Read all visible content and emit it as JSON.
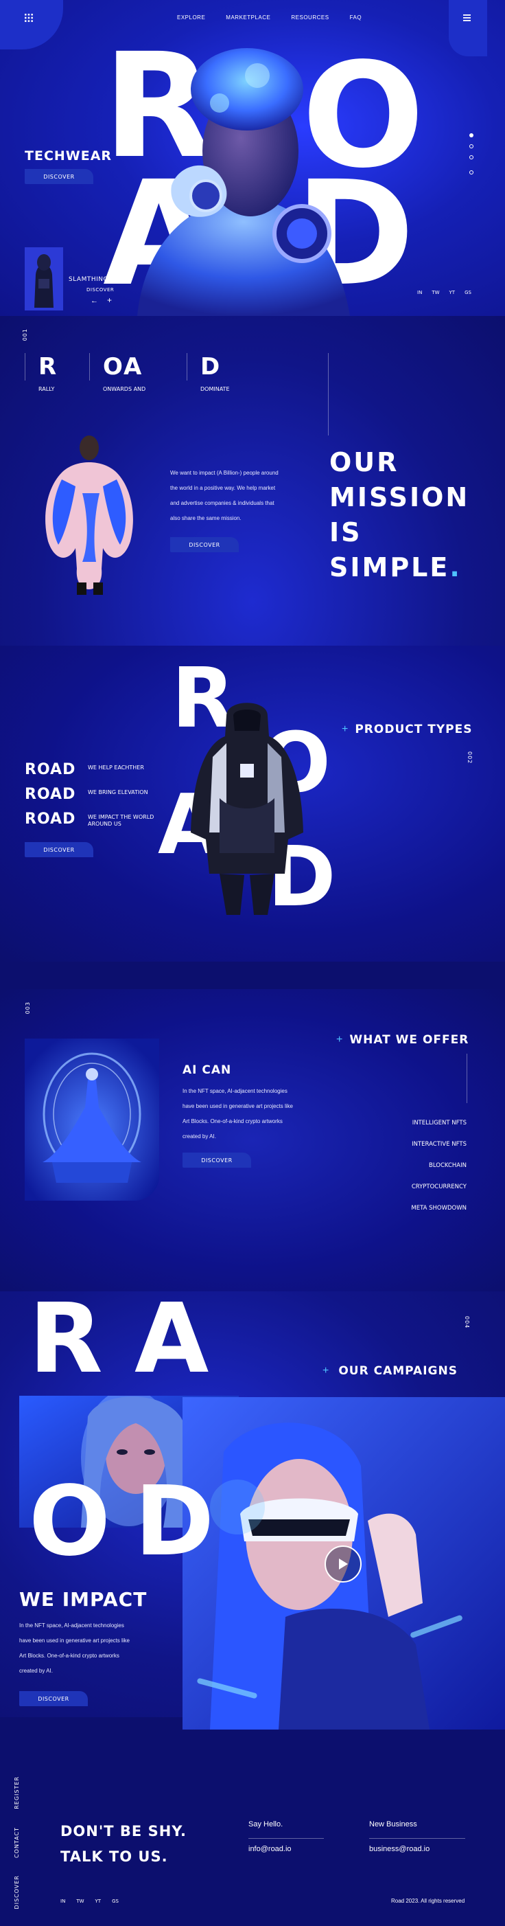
{
  "nav": {
    "items": [
      "EXPLORE",
      "MARKETPLACE",
      "RESOURCES",
      "FAQ"
    ]
  },
  "hero": {
    "big_letters": [
      "R",
      "O",
      "A",
      "D"
    ],
    "title": "TECHWEAR",
    "discover": "DISCOVER",
    "card_title": "SLAMTHINGS",
    "card_discover": "DISCOVER",
    "card_prev": "←",
    "card_next": "+",
    "socials": [
      "IN",
      "TW",
      "YT",
      "GS"
    ]
  },
  "section1": {
    "index": "001",
    "letters": [
      {
        "letter": "R",
        "label": "RALLY"
      },
      {
        "letter": "OA",
        "label": "ONWARDS AND"
      },
      {
        "letter": "D",
        "label": "DOMINATE"
      }
    ],
    "body": [
      "We want to impact (A Billion-) people around",
      "the world in a positive way. We help market",
      "and advertise companies & individuals that",
      "also share the same mission."
    ],
    "discover": "DISCOVER",
    "mission_lines": [
      "OUR",
      "MISSION",
      "IS",
      "SIMPLE"
    ],
    "mission_dot": "."
  },
  "section2": {
    "index": "002",
    "big_letters": [
      "R",
      "O",
      "A",
      "D"
    ],
    "heading_plus": "+",
    "heading": "PRODUCT TYPES",
    "rows": [
      {
        "road": "ROAD",
        "text": "WE HELP EACHTHER"
      },
      {
        "road": "ROAD",
        "text": "WE BRING ELEVATION"
      },
      {
        "road": "ROAD",
        "text": "WE IMPACT THE WORLD AROUND US"
      }
    ],
    "discover": "DISCOVER"
  },
  "section3": {
    "index": "003",
    "heading_plus": "+",
    "heading": "WHAT WE OFFER",
    "title": "AI CAN",
    "body": [
      "In the NFT space, AI-adjacent technologies",
      "have been used in generative art projects like",
      "Art Blocks. One-of-a-kind crypto artworks",
      "created by AI."
    ],
    "discover": "DISCOVER",
    "offers": [
      "INTELLIGENT NFTS",
      "INTERACTIVE NFTS",
      "BLOCKCHAIN",
      "CRYPTOCURRENCY",
      "META SHOWDOWN"
    ]
  },
  "section4": {
    "index": "004",
    "big_letters": [
      "R",
      "A",
      "O",
      "D"
    ],
    "heading_plus": "+",
    "heading": "OUR CAMPAIGNS",
    "title": "WE IMPACT",
    "body": [
      "In the NFT space, AI-adjacent technologies",
      "have been used in generative art projects like",
      "Art Blocks. One-of-a-kind crypto artworks",
      "created by AI."
    ],
    "discover": "DISCOVER"
  },
  "footer": {
    "side_links": [
      "REGISTER",
      "CONTACT",
      "DISCOVER"
    ],
    "cta_lines": [
      "DON'T BE SHY.",
      "TALK TO US."
    ],
    "hello_label": "Say Hello.",
    "hello_email": "info@road.io",
    "business_label": "New Business",
    "business_email": "business@road.io",
    "socials": [
      "IN",
      "TW",
      "YT",
      "GS"
    ],
    "copyright": "Road 2023. All rights reserved"
  },
  "colors": {
    "background": "#0c0f6e",
    "accent": "#1f34b8",
    "highlight": "#4fc3ff"
  }
}
